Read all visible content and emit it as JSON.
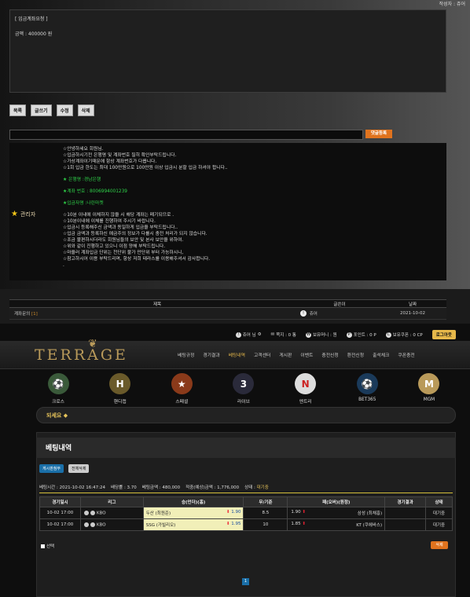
{
  "post": {
    "author_line": "작성자 : 쥬어",
    "request_title": "[ 입금계좌요청 ]",
    "amount_line": "금액 : 400000 원"
  },
  "buttons": {
    "list": "목록",
    "write": "글쓰기",
    "edit": "수정",
    "delete": "삭제"
  },
  "comment": {
    "input_placeholder": "",
    "submit_label": "댓글등록"
  },
  "admin": {
    "label": "관리자",
    "lines": [
      "☆안녕하세요 회원님.",
      "☆입금하시기전 은행명 및 계좌번호 필히 확인부탁드립니다.",
      "☆가상계좌이기때문에 항상 계좌번호가 다릅니다.",
      "☆1회 입금 한도는 최대 100만원으로 100만원 이상 입금시 분할 입금 하셔야 합니다..",
      "★ 은행명 :경남은행",
      "★계좌 번호 : 8006994001239",
      "★입금자명 :나린마켓",
      "☆10분 이내에 이체하지 않을 시 해당 계좌는 폐기되므로 .",
      "☆10분이내에 이체를 진행하여 주시기 바랍니다.",
      "☆입금시 등록해주신 금액과 동일하게 입금을 부탁드립니다..",
      "☆입금 금액과 등록하신 예금주의 정보가 다를시 충전 처리가 되지 않습니다.",
      "☆조금 불편하시더라도 회원님들의 보안 및 본사 보안을 위하여.",
      "☆위와 같이 진행하고 있으니 이점 양해 부탁드립니다.",
      "☆마을러 계좌입금 단위는 천단위 불가 만단위 부터 가능하시니,",
      "☆참고하시어 이용 부탁드리며, 항상 저희 테라스를 이용해주셔서 감사합니다.",
      "."
    ]
  },
  "list": {
    "head_title": "제목",
    "head_author": "글쓴이",
    "head_date": "날짜",
    "row_title": "계좌문의",
    "row_count": "[1]",
    "row_author": "쥬어",
    "row_date": "2021-10-02"
  },
  "user_bar": {
    "user": "쥬어 님",
    "msg": "쪽지 : 0 통",
    "money": "보유머니 : 원",
    "point": "포인트 : 0 P",
    "coupon": "보유쿠폰 : 0 CP",
    "logout": "로그아웃"
  },
  "site": {
    "logo": "TERRAGE",
    "menu": [
      "베팅규정",
      "경기결과",
      "베팅내역",
      "고객센터",
      "게시판",
      "이벤트",
      "충전신청",
      "환전신청",
      "출석체크",
      "쿠폰충전"
    ],
    "active_menu": "베팅내역",
    "games": [
      {
        "label": "크로스",
        "icon": "soccer-ball-icon",
        "color": "#3a5a3a",
        "glyph": "⚽"
      },
      {
        "label": "핸디캡",
        "icon": "handicap-icon",
        "color": "#6a5a2a",
        "glyph": "H"
      },
      {
        "label": "스페셜",
        "icon": "special-icon",
        "color": "#8a3a1a",
        "glyph": "★"
      },
      {
        "label": "라이브",
        "icon": "live-icon",
        "color": "#2a2a3a",
        "glyph": "3"
      },
      {
        "label": "엔트리",
        "icon": "ntry-icon",
        "color": "#dddddd",
        "glyph": "N"
      },
      {
        "label": "BET365",
        "icon": "bet365-icon",
        "color": "#1a3a5a",
        "glyph": "⚽"
      },
      {
        "label": "MGM",
        "icon": "mgm-icon",
        "color": "#b99a5a",
        "glyph": "M"
      }
    ],
    "marquee": "되세요 ◆"
  },
  "bet": {
    "title": "베팅내역",
    "tab_on": "게시판첨부",
    "tab_off": "전체삭제",
    "summary": {
      "time": "베팅시간 : 2021-10-02 16:47:24",
      "odds": "배당률 : 3.70",
      "amount": "베팅금액 : 480,000",
      "win": "적중(예상)금액 : 1,776,000",
      "status_label": "상태 :",
      "status_value": "대기중"
    },
    "headers": [
      "경기일시",
      "리그",
      "승(언더)(홈)",
      "무/기준",
      "패(오버)(원정)",
      "경기결과",
      "상태"
    ],
    "rows": [
      {
        "date": "10-02 17:00",
        "league": "KBO",
        "home": "두산 (최원준)",
        "home_odds": "1.90",
        "mid": "8.5",
        "away_odds": "1.90",
        "away": "삼성 (최채흥)",
        "result": "",
        "status": "대기중"
      },
      {
        "date": "10-02 17:00",
        "league": "KBO",
        "home": "SSG (가빌리오)",
        "home_odds": "1.95",
        "mid": "10",
        "away_odds": "1.85",
        "away": "KT (쿠에바스)",
        "result": "",
        "status": "대기중"
      }
    ],
    "select_all": "선택",
    "delete": "삭제",
    "page": "1"
  }
}
